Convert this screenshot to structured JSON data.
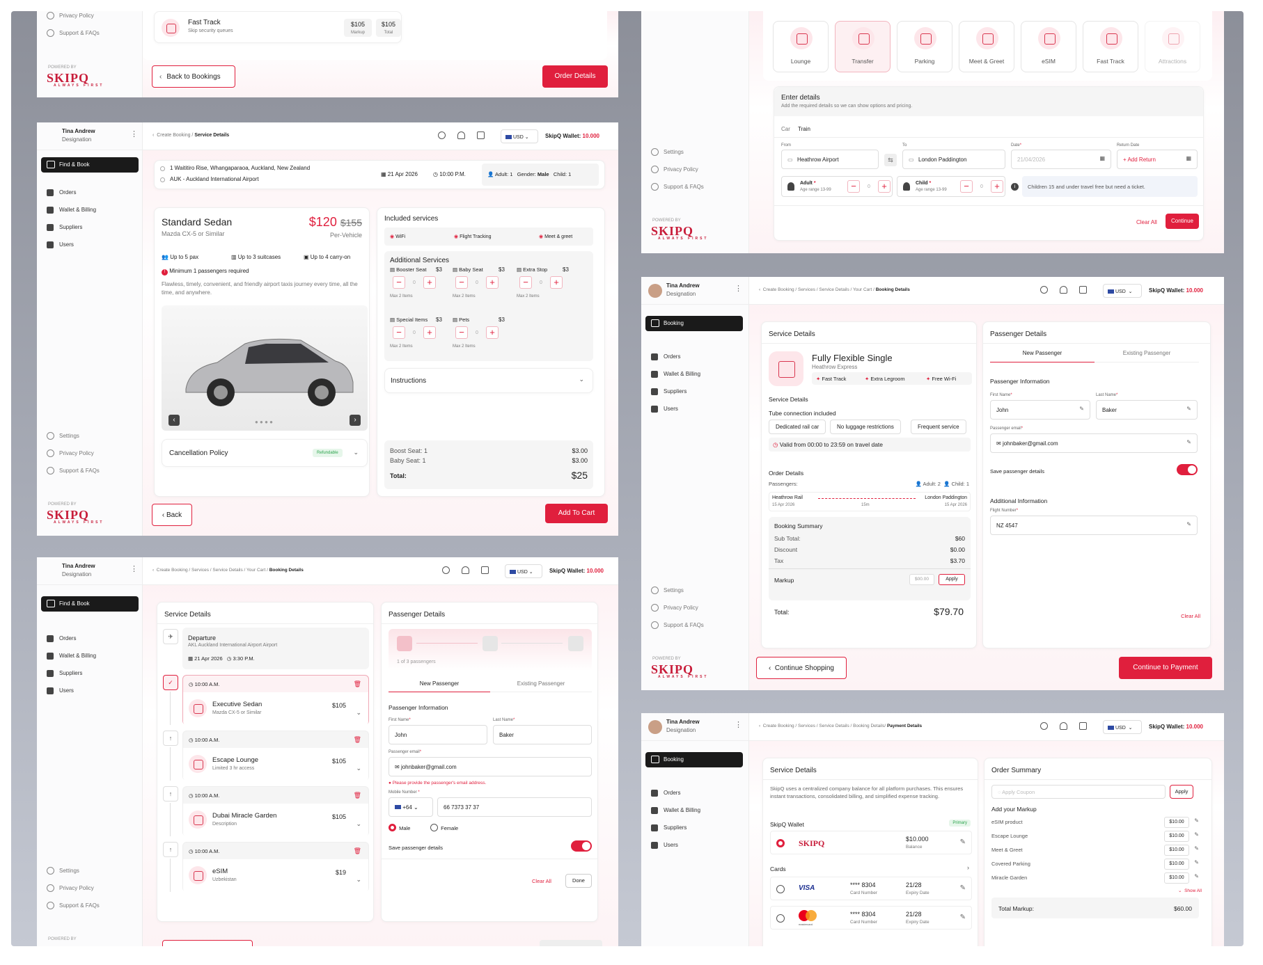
{
  "p1": {
    "sidebar": {
      "privacy": "Privacy Policy",
      "support": "Support & FAQs",
      "powered": "POWERED BY",
      "logo": "SKIPQ",
      "tagline": "ALWAYS FIRST"
    },
    "service": {
      "name": "Fast Track",
      "desc": "Skip security queues",
      "markup": "$105",
      "markup_lbl": "Markup",
      "total": "$105",
      "total_lbl": "Total"
    },
    "back": "Back to Bookings",
    "order": "Order Details"
  },
  "p2": {
    "services": [
      {
        "label": "Lounge"
      },
      {
        "label": "Transfer"
      },
      {
        "label": "Parking"
      },
      {
        "label": "Meet & Greet"
      },
      {
        "label": "eSIM"
      },
      {
        "label": "Fast Track"
      },
      {
        "label": "Attractions"
      }
    ],
    "sidebar": {
      "settings": "Settings",
      "privacy": "Privacy Policy",
      "support": "Support & FAQs",
      "powered": "POWERED BY",
      "logo": "SKIPQ",
      "tagline": "ALWAYS FIRST"
    },
    "form": {
      "title": "Enter details",
      "subtitle": "Add the required details so we can show options and pricing.",
      "tab_car": "Car",
      "tab_train": "Train",
      "from_lbl": "From",
      "from_val": "Heathrow Airport",
      "to_lbl": "To",
      "to_val": "London Paddington",
      "date_lbl": "Date",
      "date_ph": "21/04/2026",
      "ret_lbl": "Return Date",
      "ret_val": "+ Add Return",
      "adult": "Adult",
      "adult_age": "Age range 13-99",
      "adult_v": "0",
      "child": "Child",
      "child_age": "Age range 13-99",
      "child_v": "0",
      "note": "Children 15 and under travel free but need a ticket.",
      "clear": "Clear All",
      "continue": "Continue"
    }
  },
  "p3": {
    "user": {
      "name": "Tina Andrew",
      "role": "Designation"
    },
    "nav": {
      "find": "Find & Book",
      "orders": "Orders",
      "wallet": "Wallet & Billing",
      "suppliers": "Suppliers",
      "users": "Users",
      "settings": "Settings",
      "privacy": "Privacy Policy",
      "support": "Support & FAQs",
      "powered": "POWERED BY",
      "logo": "SKIPQ",
      "tagline": "ALWAYS FIRST"
    },
    "top": {
      "crumb1": "Create Booking /",
      "crumb2": "Service Details",
      "currency": "USD",
      "wallet_lbl": "SkipQ Wallet:",
      "wallet_val": "10.000"
    },
    "trip": {
      "addr1": "1 Waititiro Rise, Whangaparaoa, Auckland, New Zealand",
      "addr2": "AUK - Auckland International Airport",
      "date": "21 Apr 2026",
      "time": "10:00 P.M.",
      "adult": "Adult: 1",
      "gender_lbl": "Gender:",
      "gender": "Male",
      "child": "Child: 1"
    },
    "car": {
      "name": "Standard Sedan",
      "model": "Mazda CX-5 or Similar",
      "price": "$120",
      "old": "$155",
      "per": "Per-Vehicle",
      "pax": "Up to 5 pax",
      "suit": "Up to 3 suitcases",
      "carry": "Up to 4 carry-on",
      "min": "Minimum 1 passengers required",
      "desc": "Flawless, timely, convenient, and friendly airport taxis journey every time, all the time, and anywhere."
    },
    "cancel": {
      "label": "Cancellation Policy",
      "badge": "Refundable"
    },
    "included": {
      "title": "Included services",
      "wifi": "WiFi",
      "flight": "Flight Tracking",
      "meet": "Meet & greet"
    },
    "additional": {
      "title": "Additional Services",
      "items": [
        {
          "name": "Booster Seat",
          "price": "$3",
          "v": "0",
          "max": "Max 2 Items"
        },
        {
          "name": "Baby Seat",
          "price": "$3",
          "v": "0",
          "max": "Max 2 Items"
        },
        {
          "name": "Extra Stop",
          "price": "$3",
          "v": "0",
          "max": "Max 2 Items"
        },
        {
          "name": "Special Items",
          "price": "$3",
          "v": "0",
          "max": "Max 2 Items"
        },
        {
          "name": "Pets",
          "price": "$3",
          "v": "0",
          "max": "Max 2 Items"
        }
      ]
    },
    "instructions": "Instructions",
    "summary": {
      "l1": "Boost Seat: 1",
      "v1": "$3.00",
      "l2": "Baby Seat: 1",
      "v2": "$3.00",
      "total_lbl": "Total:",
      "total": "$25"
    },
    "back": "Back",
    "add": "Add To Cart"
  },
  "p4": {
    "user": {
      "name": "Tina Andrew",
      "role": "Designation"
    },
    "nav": {
      "booking": "Booking",
      "orders": "Orders",
      "wallet": "Wallet & Billing",
      "suppliers": "Suppliers",
      "users": "Users",
      "settings": "Settings",
      "privacy": "Privacy Policy",
      "support": "Support & FAQs",
      "powered": "POWERED BY",
      "logo": "SKIPQ",
      "tagline": "ALWAYS FIRST"
    },
    "top": {
      "c1": "Create Booking /",
      "c2": "Services /",
      "c3": "Service Details /",
      "c4": "Your Cart /",
      "c5": "Booking Details",
      "currency": "USD",
      "wallet_lbl": "SkipQ Wallet:",
      "wallet_val": "10.000"
    },
    "svc": {
      "title": "Service Details",
      "name": "Fully Flexible Single",
      "sub": "Heathrow Express",
      "f1": "Fast Track",
      "f2": "Extra Legroom",
      "f3": "Free Wi-Fi",
      "det": "Service Details",
      "tube": "Tube connection included",
      "t1": "Dedicated rail car",
      "t2": "No luggage restrictions",
      "t3": "Frequent service",
      "valid": "Valid from 00:00 to 23:59 on travel date"
    },
    "order": {
      "title": "Order Details",
      "pass": "Passengers:",
      "adult": "Adult: 2",
      "child": "Child: 1",
      "from": "Heathrow Rail",
      "from_d": "15 Apr 2026",
      "dur": "15m",
      "to": "London Paddington",
      "to_d": "15 Apr 2026"
    },
    "sum": {
      "title": "Booking Summary",
      "sub_l": "Sub Total:",
      "sub": "$60",
      "disc_l": "Discount",
      "disc": "$0.00",
      "tax_l": "Tax",
      "tax": "$3.70",
      "mk_l": "Markup",
      "mk_ph": "$00.00",
      "apply": "Apply",
      "tot_l": "Total:",
      "tot": "$79.70"
    },
    "pax": {
      "title": "Passenger Details",
      "tab1": "New Passenger",
      "tab2": "Existing Passenger",
      "info": "Passenger Information",
      "fn_l": "First Name",
      "fn": "John",
      "ln_l": "Last Name",
      "ln": "Baker",
      "em_l": "Passenger email",
      "em": "johnbaker@gmail.com",
      "save": "Save passenger details",
      "add": "Additional Information",
      "fl_l": "Flight Number",
      "fl": "NZ 4547",
      "clear": "Clear All"
    },
    "cont": "Continue Shopping",
    "pay": "Continue to Payment"
  },
  "p5": {
    "user": {
      "name": "Tina Andrew",
      "role": "Designation"
    },
    "nav": {
      "find": "Find & Book",
      "orders": "Orders",
      "wallet": "Wallet & Billing",
      "suppliers": "Suppliers",
      "users": "Users",
      "settings": "Settings",
      "privacy": "Privacy Policy",
      "support": "Support & FAQs",
      "powered": "POWERED BY"
    },
    "top": {
      "c1": "Create Booking /",
      "c2": "Services /",
      "c3": "Service Details /",
      "c4": "Your Cart /",
      "c5": "Booking Details",
      "currency": "USD",
      "wallet_lbl": "SkipQ Wallet:",
      "wallet_val": "10.000"
    },
    "svc": {
      "title": "Service Details",
      "dep": "Departure",
      "dep_sub": "AKL Auckland International Airport Airport",
      "dep_date": "21 Apr 2026",
      "dep_time": "3:30 P.M.",
      "items": [
        {
          "time": "10:00 A.M.",
          "name": "Executive Sedan",
          "sub": "Mazda CX-5 or Similar",
          "price": "$105"
        },
        {
          "time": "10:00 A.M.",
          "name": "Escape Lounge",
          "sub": "Limited 3 hr access",
          "price": "$105"
        },
        {
          "time": "10:00 A.M.",
          "name": "Dubai Miracle Garden",
          "sub": "Description",
          "price": "$105"
        },
        {
          "time": "10:00 A.M.",
          "name": "eSIM",
          "sub": "Uzbekistan",
          "price": "$19"
        }
      ]
    },
    "pax": {
      "title": "Passenger Details",
      "count": "1 of 3 passengers",
      "tab1": "New Passenger",
      "tab2": "Existing Passenger",
      "info": "Passenger Information",
      "fn_l": "First Name",
      "fn": "John",
      "ln_l": "Last Name",
      "ln": "Baker",
      "em_l": "Passenger email",
      "em": "johnbaker@gmail.com",
      "err": "Please provide the passenger's email address.",
      "mob_l": "Mobile Number",
      "cc": "+64",
      "mob": "66 7373 37 37",
      "male": "Male",
      "female": "Female",
      "save": "Save passenger details",
      "clear": "Clear All",
      "done": "Done"
    }
  },
  "p6": {
    "user": {
      "name": "Tina Andrew",
      "role": "Designation"
    },
    "nav": {
      "booking": "Booking",
      "orders": "Orders",
      "wallet": "Wallet & Billing",
      "suppliers": "Suppliers",
      "users": "Users"
    },
    "top": {
      "c1": "Create Booking /",
      "c2": "Services /",
      "c3": "Service Details /",
      "c4": "Booking Details/",
      "c5": "Payment Details",
      "currency": "USD",
      "wallet_lbl": "SkipQ Wallet:",
      "wallet_val": "10.000"
    },
    "svc": {
      "title": "Service Details",
      "desc": "SkipQ uses a centralized company balance for all platform purchases. This ensures instant transactions, consolidated billing, and simplified expense tracking.",
      "wallet": "SkipQ Wallet",
      "primary": "Primary",
      "logo": "SKIPQ",
      "bal": "$10.000",
      "bal_l": "Balance",
      "cards": "Cards",
      "c1_brand": "VISA",
      "c1_num": "**** 8304",
      "c1_num_l": "Card Number",
      "c1_exp": "21/28",
      "c1_exp_l": "Expiry Date",
      "c2_num": "**** 8304",
      "c2_num_l": "Card Number",
      "c2_exp": "21/28",
      "c2_exp_l": "Expiry Date",
      "c2_brand": "mastercard"
    },
    "ord": {
      "title": "Order Summary",
      "coupon": "Apply Coupon",
      "apply": "Apply",
      "markup": "Add your Markup",
      "items": [
        {
          "name": "eSIM product",
          "v": "$10.00"
        },
        {
          "name": "Escape Lounge",
          "v": "$10.00"
        },
        {
          "name": "Meet & Greet",
          "v": "$10.00"
        },
        {
          "name": "Covered Parking",
          "v": "$10.00"
        },
        {
          "name": "Miracle Garden",
          "v": "$10.00"
        }
      ],
      "show": "Show All",
      "tot_l": "Total Markup:",
      "tot": "$60.00"
    }
  }
}
